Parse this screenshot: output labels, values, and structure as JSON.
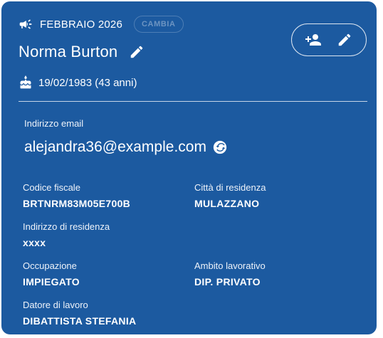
{
  "header": {
    "month_label": "FEBBRAIO 2026",
    "change_button_label": "CAMBIA",
    "name": "Norma Burton",
    "birth_text": "19/02/1983 (43 anni)"
  },
  "email": {
    "label": "Indirizzo email",
    "value": "alejandra36@example.com"
  },
  "fields": {
    "codice_fiscale": {
      "label": "Codice fiscale",
      "value": "BRTNRM83M05E700B"
    },
    "citta": {
      "label": "Città di residenza",
      "value": "MULAZZANO"
    },
    "indirizzo": {
      "label": "Indirizzo di residenza",
      "value": "xxxx"
    },
    "occupazione": {
      "label": "Occupazione",
      "value": "IMPIEGATO"
    },
    "ambito": {
      "label": "Ambito lavorativo",
      "value": "DIP. PRIVATO"
    },
    "datore": {
      "label": "Datore di lavoro",
      "value": "DIBATTISTA STEFANIA"
    }
  },
  "icons": {
    "campaign": "megaphone-icon",
    "edit": "pencil-icon",
    "add_person": "person-add-icon",
    "cake": "cake-icon",
    "sync": "sync-icon"
  },
  "colors": {
    "card_background": "#1c5aa0",
    "text": "#ffffff"
  }
}
